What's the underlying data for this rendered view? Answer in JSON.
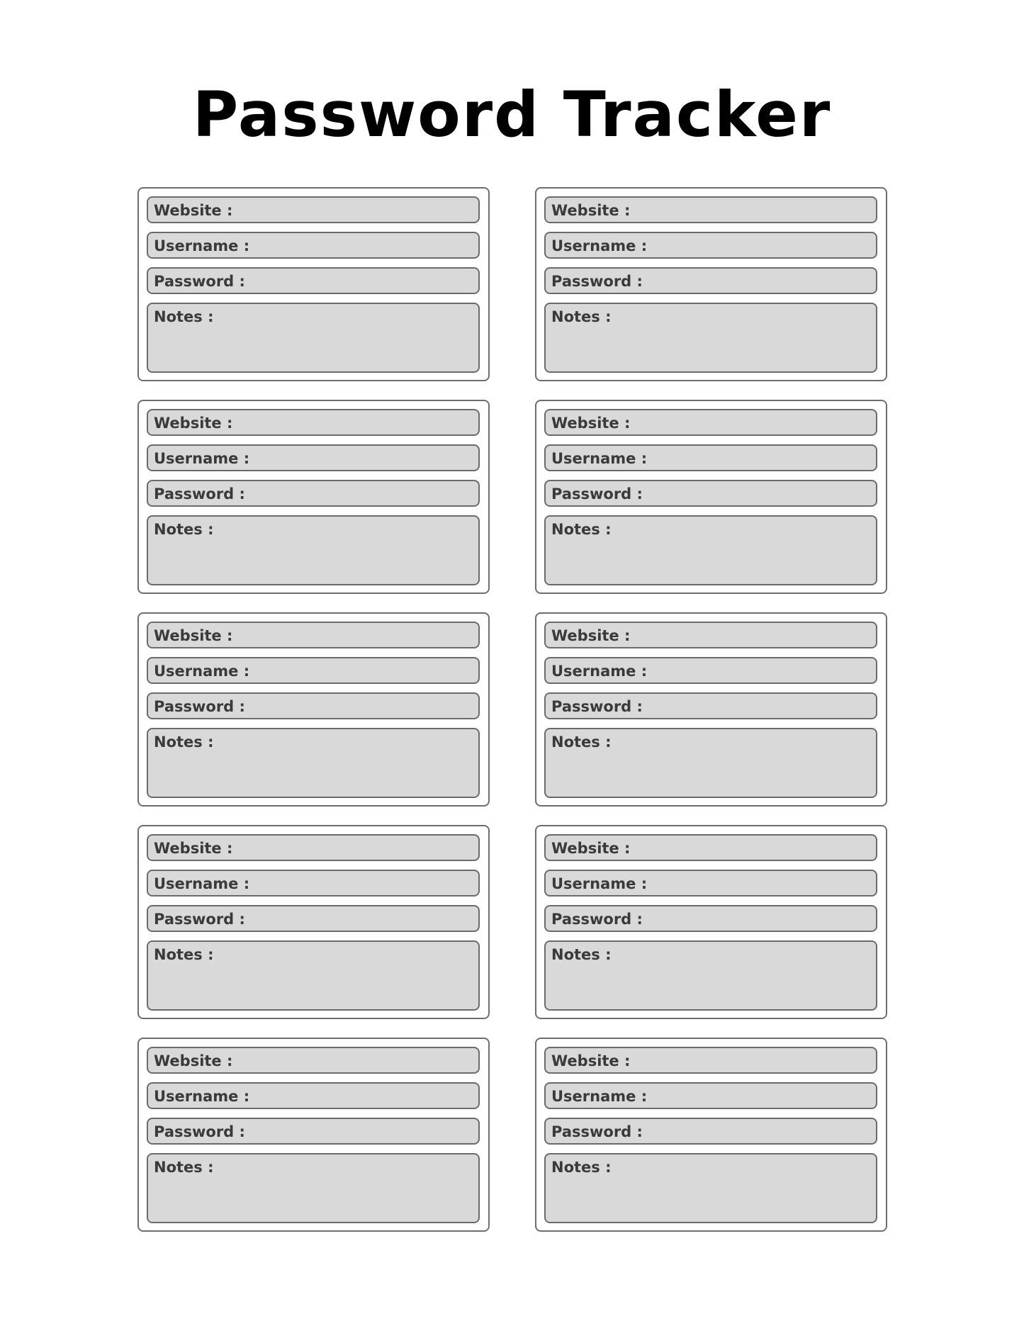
{
  "header": {
    "title": "Password Tracker"
  },
  "field_labels": {
    "website": "Website :",
    "username": "Username :",
    "password": "Password :",
    "notes": "Notes :"
  },
  "entries": [
    {
      "website": "",
      "username": "",
      "password": "",
      "notes": ""
    },
    {
      "website": "",
      "username": "",
      "password": "",
      "notes": ""
    },
    {
      "website": "",
      "username": "",
      "password": "",
      "notes": ""
    },
    {
      "website": "",
      "username": "",
      "password": "",
      "notes": ""
    },
    {
      "website": "",
      "username": "",
      "password": "",
      "notes": ""
    },
    {
      "website": "",
      "username": "",
      "password": "",
      "notes": ""
    },
    {
      "website": "",
      "username": "",
      "password": "",
      "notes": ""
    },
    {
      "website": "",
      "username": "",
      "password": "",
      "notes": ""
    },
    {
      "website": "",
      "username": "",
      "password": "",
      "notes": ""
    },
    {
      "website": "",
      "username": "",
      "password": "",
      "notes": ""
    }
  ],
  "colors": {
    "card_border": "#6e6e6e",
    "field_fill": "#d9d9d9",
    "field_border": "#6b6b6b",
    "label_text": "#3a3a3a",
    "title_text": "#000000"
  }
}
